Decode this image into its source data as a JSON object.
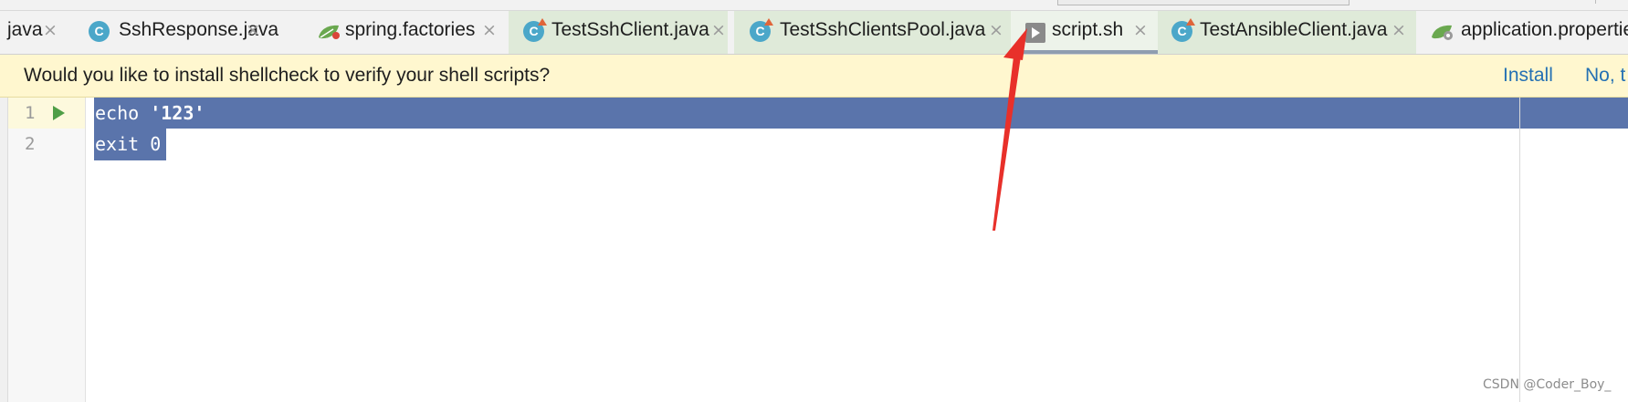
{
  "tabs": [
    {
      "label": "java",
      "icon": "none"
    },
    {
      "label": "SshResponse.java",
      "icon": "java-class-icon"
    },
    {
      "label": "spring.factories",
      "icon": "spring-leaf-icon"
    },
    {
      "label": "TestSshClient.java",
      "icon": "java-runnable-class-icon"
    },
    {
      "label": "TestSshClientsPool.java",
      "icon": "java-runnable-class-icon"
    },
    {
      "label": "script.sh",
      "icon": "shell-script-icon",
      "active": true
    },
    {
      "label": "TestAnsibleClient.java",
      "icon": "java-runnable-class-icon"
    },
    {
      "label": "application.propertie",
      "icon": "spring-config-icon"
    }
  ],
  "close_glyph": "×",
  "banner": {
    "message": "Would you like to install shellcheck to verify your shell scripts?",
    "install_label": "Install",
    "no_label": "No, t"
  },
  "editor": {
    "line_numbers": [
      "1",
      "2"
    ],
    "lines": [
      {
        "keyword": "echo ",
        "string": "'123'"
      },
      {
        "keyword": "exit ",
        "string": "0"
      }
    ]
  },
  "watermark": "CSDN @Coder_Boy_",
  "colors": {
    "selection": "#5a74ab",
    "banner_bg": "#fff7cf",
    "link": "#2470b3",
    "annotation_arrow": "#e8302a"
  }
}
